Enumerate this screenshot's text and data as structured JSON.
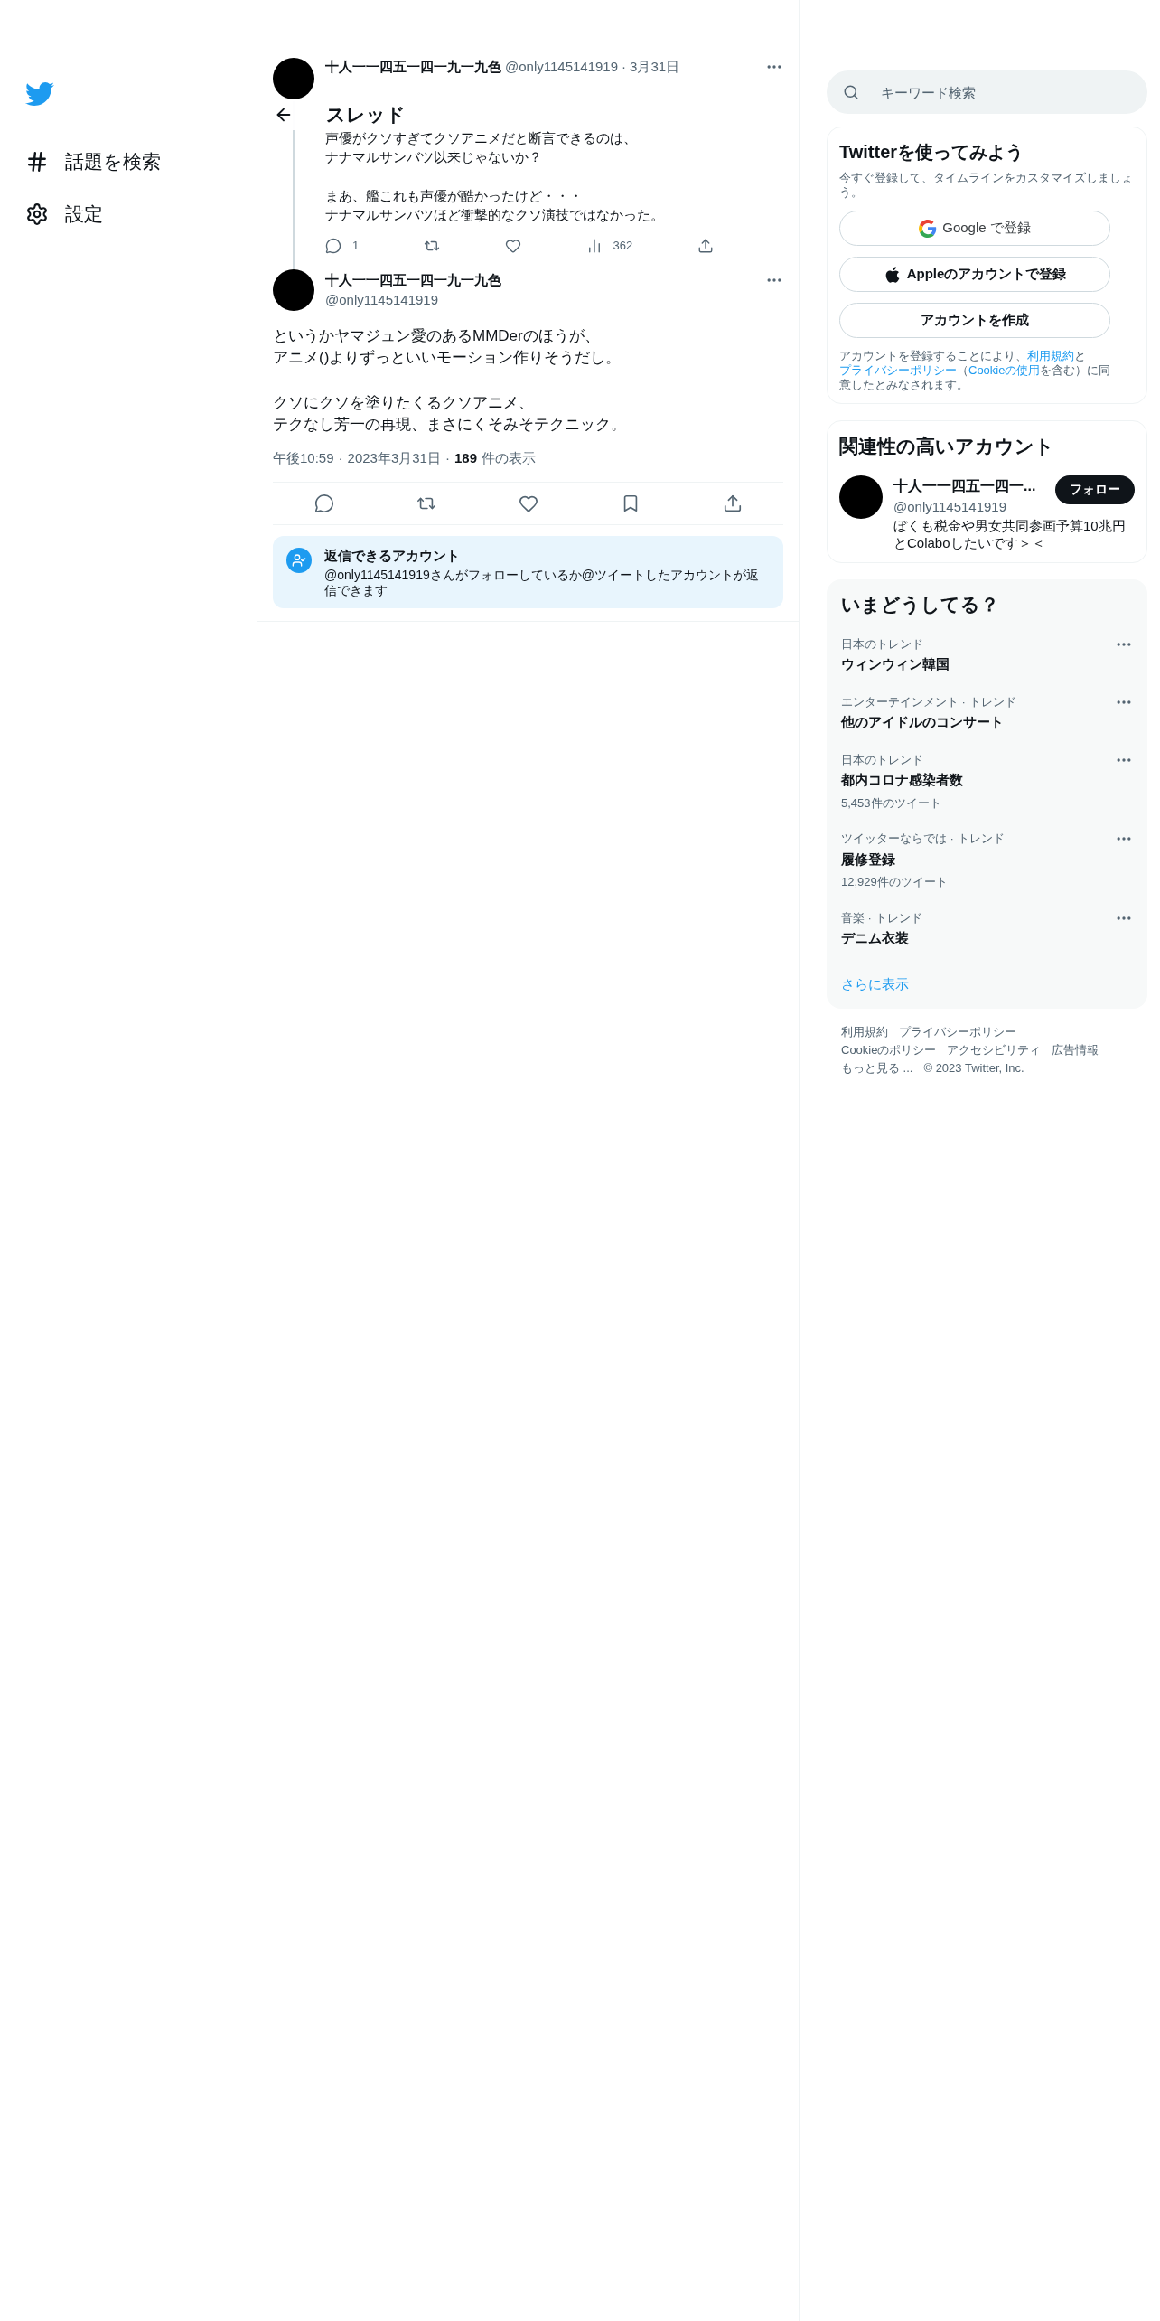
{
  "nav": {
    "items": [
      {
        "kind": "hashtag",
        "label": "話題を検索"
      },
      {
        "kind": "settings",
        "label": "設定"
      }
    ]
  },
  "header": {
    "title": "スレッド"
  },
  "parent_tweet": {
    "name": "十人一一四五一四一九一九色",
    "handle": "@only1145141919",
    "separator": "·",
    "date": "3月31日",
    "paragraphs": [
      [
        "声優がクソすぎてクソアニメだと断言できるのは、",
        "ナナマルサンバツ以来じゃないか？"
      ],
      [
        "まあ、艦これも声優が酷かったけど・・・",
        "ナナマルサンバツほど衝撃的なクソ演技ではなかった。"
      ]
    ],
    "actions": [
      {
        "kind": "reply",
        "count": "1"
      },
      {
        "kind": "retweet"
      },
      {
        "kind": "like"
      },
      {
        "kind": "views",
        "count": "362"
      },
      {
        "kind": "share"
      }
    ]
  },
  "main_tweet": {
    "name": "十人一一四五一四一九一九色",
    "handle": "@only1145141919",
    "paragraphs": [
      [
        "というかヤマジュン愛のあるMMDerのほうが、",
        "アニメ()よりずっといいモーション作りそうだし。"
      ],
      [
        "クソにクソを塗りたくるクソアニメ、",
        "テクなし芳一の再現、まさにくそみそテクニック。"
      ]
    ],
    "time": "午後10:59",
    "separator": "·",
    "date": "2023年3月31日",
    "views": "189",
    "views_label": "件の表示",
    "actions": [
      {
        "kind": "reply"
      },
      {
        "kind": "retweet"
      },
      {
        "kind": "like"
      },
      {
        "kind": "bookmark"
      },
      {
        "kind": "share"
      }
    ]
  },
  "reply_notice": {
    "title": "返信できるアカウント",
    "text": "@only1145141919さんがフォローしているか@ツイートしたアカウントが返信できます"
  },
  "search": {
    "placeholder": "キーワード検索"
  },
  "signup": {
    "title": "Twitterを使ってみよう",
    "subtitle": "今すぐ登録して、タイムラインをカスタマイズしましょう。",
    "buttons": [
      {
        "kind": "google",
        "label": "Google で登録"
      },
      {
        "kind": "apple",
        "label": "Appleのアカウントで登録"
      },
      {
        "kind": "create",
        "label": "アカウントを作成"
      }
    ],
    "legal": [
      {
        "text": "アカウントを登録することにより、",
        "link": false
      },
      {
        "text": "利用規約",
        "link": true
      },
      {
        "text": "と",
        "link": false
      },
      {
        "text": "プライバシーポリシー",
        "link": true
      },
      {
        "text": "（",
        "link": false
      },
      {
        "text": "Cookieの使用",
        "link": true
      },
      {
        "text": "を含む）に同意したとみなされます。",
        "link": false
      }
    ]
  },
  "who_to_follow": {
    "title": "関連性の高いアカウント",
    "accounts": [
      {
        "name": "十人一一四五一四一...",
        "handle": "@only1145141919",
        "bio": "ぼくも税金や男女共同参画予算10兆円とColaboしたいです＞＜",
        "button": "フォロー"
      }
    ]
  },
  "trends": {
    "title": "いまどうしてる？",
    "items": [
      {
        "context": "日本のトレンド",
        "name": "ウィンウィン韓国"
      },
      {
        "context": "エンターテインメント · トレンド",
        "name": "他のアイドルのコンサート"
      },
      {
        "context": "日本のトレンド",
        "name": "都内コロナ感染者数",
        "count": "5,453件のツイート"
      },
      {
        "context": "ツイッターならでは · トレンド",
        "name": "履修登録",
        "count": "12,929件のツイート"
      },
      {
        "context": "音楽 · トレンド",
        "name": "デニム衣装"
      }
    ],
    "more": "さらに表示"
  },
  "footer": {
    "links": [
      "利用規約",
      "プライバシーポリシー",
      "Cookieのポリシー",
      "アクセシビリティ",
      "広告情報",
      "もっと見る ..."
    ],
    "copyright": "© 2023 Twitter, Inc."
  }
}
